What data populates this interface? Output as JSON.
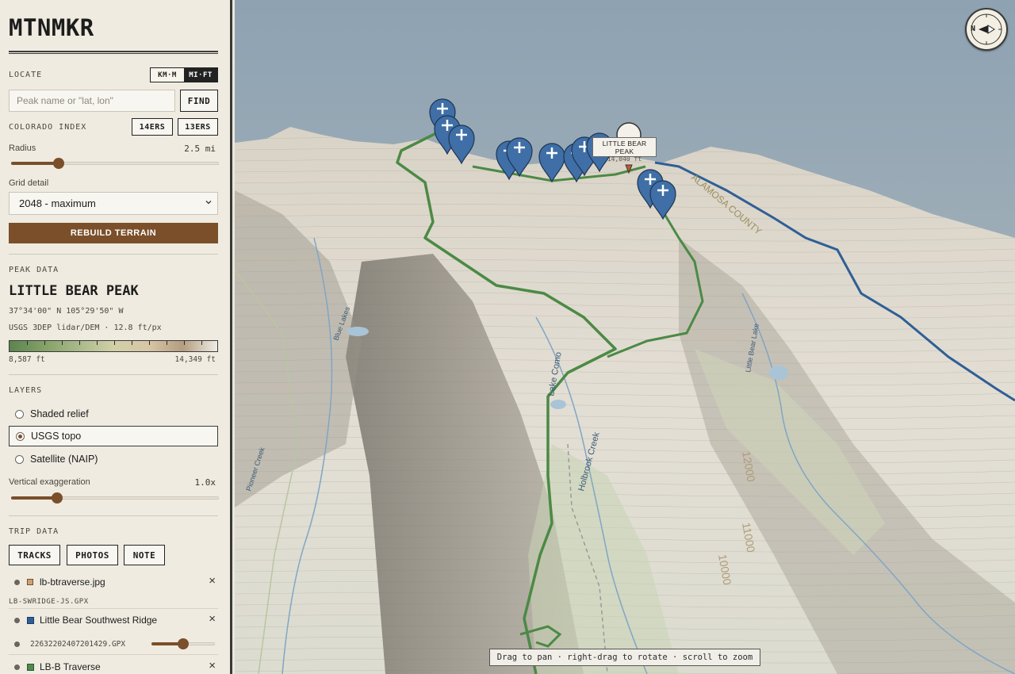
{
  "app": {
    "title": "MTNMKR"
  },
  "locate": {
    "label": "LOCATE",
    "units": [
      "KM·M",
      "MI·FT"
    ],
    "active_unit": "MI·FT",
    "search_placeholder": "Peak name or \"lat, lon\"",
    "find_label": "FIND"
  },
  "index": {
    "label": "COLORADO INDEX",
    "btn_14ers": "14ERS",
    "btn_13ers": "13ERS"
  },
  "radius": {
    "label": "Radius",
    "value_text": "2.5 mi",
    "fraction": 0.23
  },
  "grid": {
    "label": "Grid detail",
    "selected": "2048 - maximum"
  },
  "rebuild_label": "REBUILD TERRAIN",
  "peak": {
    "section": "PEAK DATA",
    "name": "LITTLE BEAR PEAK",
    "coords": "37°34'00\" N 105°29'50\" W",
    "source": "USGS 3DEP lidar/DEM · 12.8 ft/px",
    "elev_min": "8,587 ft",
    "elev_max": "14,349 ft"
  },
  "layers": {
    "section": "LAYERS",
    "options": [
      "Shaded relief",
      "USGS topo",
      "Satellite (NAIP)"
    ],
    "selected_index": 1
  },
  "exaggeration": {
    "label": "Vertical exaggeration",
    "value_text": "1.0x",
    "fraction": 0.22
  },
  "trip": {
    "section": "TRIP DATA",
    "tabs": [
      "TRACKS",
      "PHOTOS",
      "NOTE"
    ],
    "photo_file": "lb-btraverse.jpg",
    "group_label": "LB-SWRIDGE-JS.GPX",
    "track1_name": "Little Bear Southwest Ridge",
    "track1_color": "#2f5f96",
    "sub_file": "22632202407201429.GPX",
    "sub_fraction": 0.5,
    "track2_name": "LB-B Traverse",
    "track2_color": "#4f8a4c",
    "remove_glyph": "×"
  },
  "map": {
    "compass_letter": "N",
    "tooltip_title": "LITTLE BEAR PEAK",
    "tooltip_elev": "14,040 ft",
    "hint": "Drag to pan · right-drag to rotate · scroll to zoom",
    "sky_color": "#8da0b0",
    "route_green": "#4b8a45",
    "route_blue": "#2f5f96",
    "marker_blue": "#3f6fa6",
    "labels": [
      "Lake Como",
      "Holbrook Creek",
      "Little Bear Lake",
      "Blue Lakes",
      "Pioneer Creek",
      "ALAMOSA COUNTY",
      "12000",
      "11000",
      "10000"
    ]
  }
}
